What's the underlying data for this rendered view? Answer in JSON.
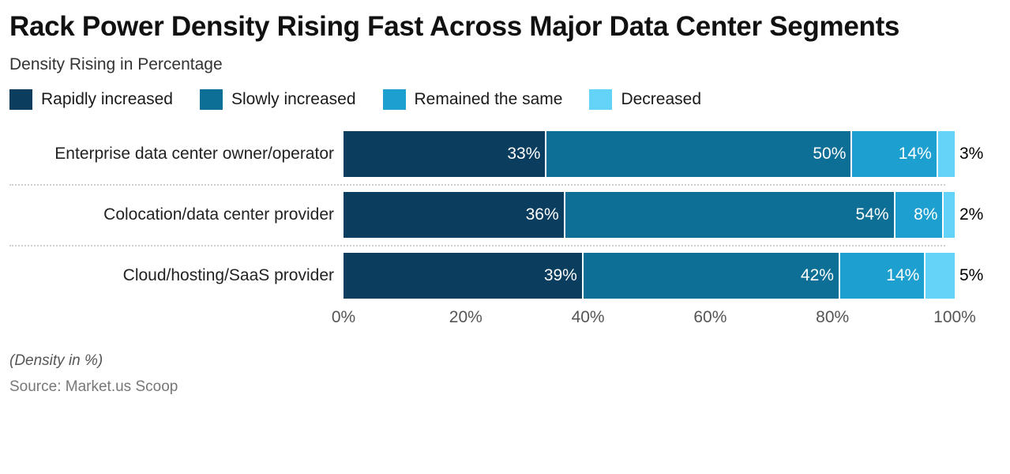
{
  "header": {
    "title": "Rack Power Density Rising Fast Across Major Data Center Segments",
    "subtitle": "Density Rising in Percentage"
  },
  "legend": {
    "items": [
      {
        "label": "Rapidly increased",
        "color": "#0a3d5e"
      },
      {
        "label": "Slowly increased",
        "color": "#0d6e96"
      },
      {
        "label": "Remained the same",
        "color": "#1d9fd0"
      },
      {
        "label": "Decreased",
        "color": "#63d3f7"
      }
    ]
  },
  "footer": {
    "note": "(Density in %)",
    "source": "Source: Market.us Scoop"
  },
  "chart_data": {
    "type": "bar",
    "orientation": "horizontal",
    "stacked": true,
    "normalized_percent": true,
    "title": "Rack Power Density Rising Fast Across Major Data Center Segments",
    "subtitle": "Density Rising in Percentage",
    "xlabel": "",
    "ylabel": "",
    "xlim": [
      0,
      100
    ],
    "xticks": [
      0,
      20,
      40,
      60,
      80,
      100
    ],
    "xtick_labels": [
      "0%",
      "20%",
      "40%",
      "60%",
      "80%",
      "100%"
    ],
    "grid": false,
    "legend_position": "top-left",
    "categories": [
      "Enterprise data center owner/operator",
      "Colocation/data center provider",
      "Cloud/hosting/SaaS provider"
    ],
    "series": [
      {
        "name": "Rapidly increased",
        "color": "#0a3d5e",
        "values": [
          33,
          36,
          39
        ],
        "labels": [
          "33%",
          "36%",
          "39%"
        ]
      },
      {
        "name": "Slowly increased",
        "color": "#0d6e96",
        "values": [
          50,
          54,
          42
        ],
        "labels": [
          "50%",
          "54%",
          "42%"
        ]
      },
      {
        "name": "Remained the same",
        "color": "#1d9fd0",
        "values": [
          14,
          8,
          14
        ],
        "labels": [
          "14%",
          "8%",
          "14%"
        ]
      },
      {
        "name": "Decreased",
        "color": "#63d3f7",
        "values": [
          3,
          2,
          5
        ],
        "labels": [
          "3%",
          "2%",
          "5%"
        ]
      }
    ],
    "rows": [
      {
        "label": "Enterprise data center owner/operator",
        "segments": [
          {
            "name": "Rapidly increased",
            "value": 33,
            "label": "33%"
          },
          {
            "name": "Slowly increased",
            "value": 50,
            "label": "50%"
          },
          {
            "name": "Remained the same",
            "value": 14,
            "label": "14%"
          },
          {
            "name": "Decreased",
            "value": 3,
            "label": "3%"
          }
        ]
      },
      {
        "label": "Colocation/data center provider",
        "segments": [
          {
            "name": "Rapidly increased",
            "value": 36,
            "label": "36%"
          },
          {
            "name": "Slowly increased",
            "value": 54,
            "label": "54%"
          },
          {
            "name": "Remained the same",
            "value": 8,
            "label": "8%"
          },
          {
            "name": "Decreased",
            "value": 2,
            "label": "2%"
          }
        ]
      },
      {
        "label": "Cloud/hosting/SaaS provider",
        "segments": [
          {
            "name": "Rapidly increased",
            "value": 39,
            "label": "39%"
          },
          {
            "name": "Slowly increased",
            "value": 42,
            "label": "42%"
          },
          {
            "name": "Remained the same",
            "value": 14,
            "label": "14%"
          },
          {
            "name": "Decreased",
            "value": 5,
            "label": "5%"
          }
        ]
      }
    ]
  }
}
